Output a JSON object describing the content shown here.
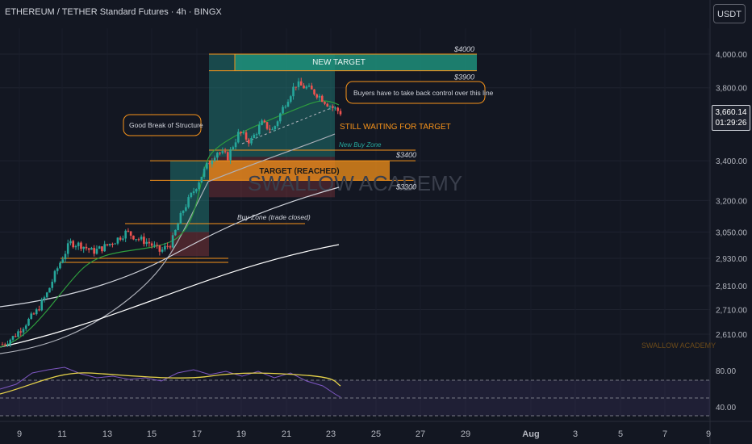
{
  "header": {
    "title": "ETHEREUM / TETHER Standard Futures · 4h · BINGX",
    "currency_label": "USDT"
  },
  "price_label": {
    "price": "3,660.14",
    "countdown": "01:29:26"
  },
  "watermark": "SWALLOW ACADEMY",
  "footer_brand": "SWALLOW ACADEMY",
  "colors": {
    "background": "#131722",
    "up": "#26a69a",
    "down": "#ef5350",
    "accent": "#f7931a",
    "green_ma": "#2e9e3e",
    "rsi": "#7e57c2",
    "rsi_ma": "#e6d34a"
  },
  "chart_data": {
    "type": "line",
    "title": "ETHEREUM / TETHER Standard Futures · 4h · BINGX",
    "y_ticks": [
      "4,000.00",
      "3,800.00",
      "3,400.00",
      "3,200.00",
      "3,050.00",
      "2,930.00",
      "2,810.00",
      "2,710.00",
      "2,610.00"
    ],
    "x_ticks": [
      "9",
      "11",
      "13",
      "15",
      "17",
      "19",
      "21",
      "23",
      "25",
      "27",
      "29",
      "Aug",
      "3",
      "5",
      "7",
      "9"
    ],
    "ylim": [
      2560,
      4100
    ],
    "scale": "log",
    "grid": true,
    "price_series": [
      2570,
      2600,
      2650,
      2700,
      2780,
      2900,
      3000,
      2990,
      2960,
      2980,
      3010,
      3050,
      3020,
      3000,
      2960,
      3000,
      3150,
      3250,
      3360,
      3450,
      3420,
      3550,
      3500,
      3600,
      3560,
      3700,
      3820,
      3800,
      3760,
      3700,
      3660
    ],
    "annotations": {
      "new_target": "NEW TARGET",
      "new_target_top": "$4000",
      "new_target_bottom": "$3900",
      "buyers_note": "Buyers have to take back control over this line",
      "still_waiting": "STILL WAITING FOR TARGET",
      "good_break": "Good Break of Structure",
      "new_buy_zone": "New Buy Zone",
      "target_reached": "TARGET (REACHED)",
      "target_top": "$3400",
      "target_bottom": "$3300",
      "buy_zone_closed": "Buy Zone (trade closed)"
    },
    "rsi": {
      "ticks": [
        "80.00",
        "40.00"
      ],
      "levels": [
        70,
        50,
        30
      ]
    }
  }
}
